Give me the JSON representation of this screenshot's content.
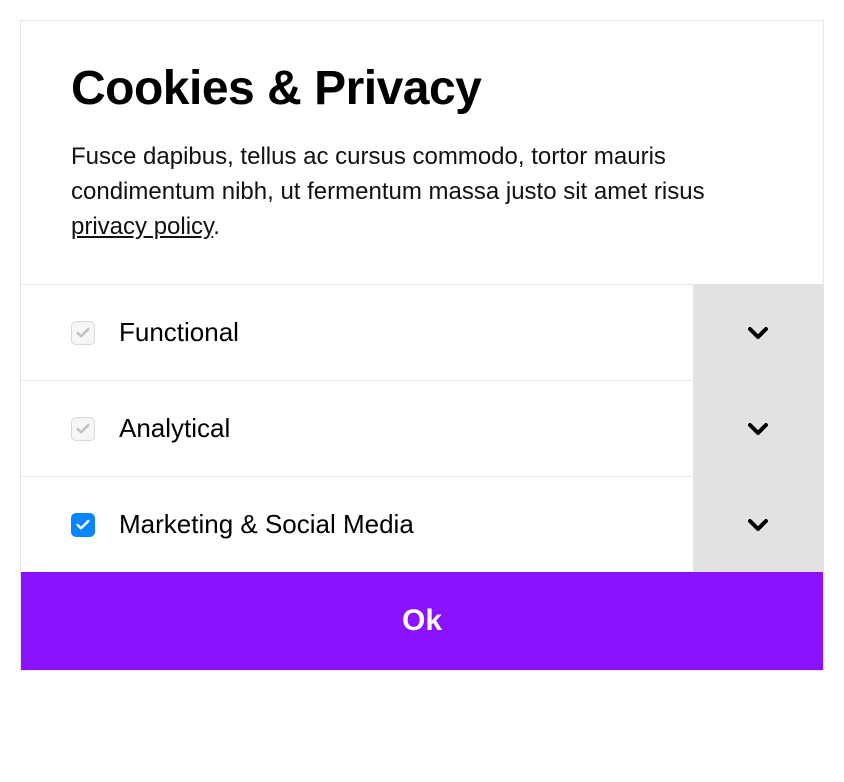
{
  "title": "Cookies & Privacy",
  "description_prefix": "Fusce dapibus, tellus ac cursus commodo, tortor mauris condimentum nibh, ut fermentum massa justo sit amet risus ",
  "privacy_link_text": "privacy policy",
  "description_suffix": ".",
  "categories": [
    {
      "label": "Functional",
      "checked": true,
      "disabled": true
    },
    {
      "label": "Analytical",
      "checked": true,
      "disabled": true
    },
    {
      "label": "Marketing & Social Media",
      "checked": true,
      "disabled": false
    }
  ],
  "ok_label": "Ok",
  "colors": {
    "accent": "#8a12ff",
    "checkbox_active": "#0a84ff"
  }
}
